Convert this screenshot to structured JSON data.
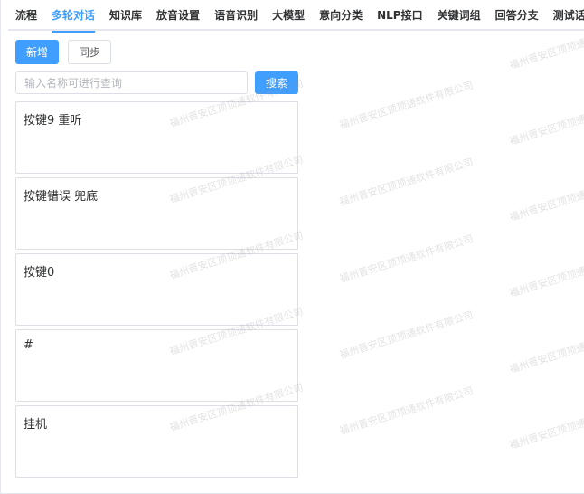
{
  "tabs": [
    {
      "label": "流程",
      "active": false
    },
    {
      "label": "多轮对话",
      "active": true
    },
    {
      "label": "知识库",
      "active": false
    },
    {
      "label": "放音设置",
      "active": false
    },
    {
      "label": "语音识别",
      "active": false
    },
    {
      "label": "大模型",
      "active": false
    },
    {
      "label": "意向分类",
      "active": false
    },
    {
      "label": "NLP接口",
      "active": false
    },
    {
      "label": "关键词组",
      "active": false
    },
    {
      "label": "回答分支",
      "active": false
    },
    {
      "label": "测试话术",
      "active": false
    }
  ],
  "toolbar": {
    "add_label": "新增",
    "sync_label": "同步"
  },
  "search": {
    "placeholder": "输入名称可进行查询",
    "value": "",
    "button_label": "搜索"
  },
  "cards": [
    {
      "title": "按键9 重听"
    },
    {
      "title": "按键错误 兜底"
    },
    {
      "title": "按键0"
    },
    {
      "title": "#"
    },
    {
      "title": "挂机"
    }
  ],
  "watermark": {
    "text": "福州晋安区顶顶通软件有限公司"
  },
  "colors": {
    "accent": "#409eff",
    "border": "#dcdfe6",
    "text": "#303133"
  }
}
